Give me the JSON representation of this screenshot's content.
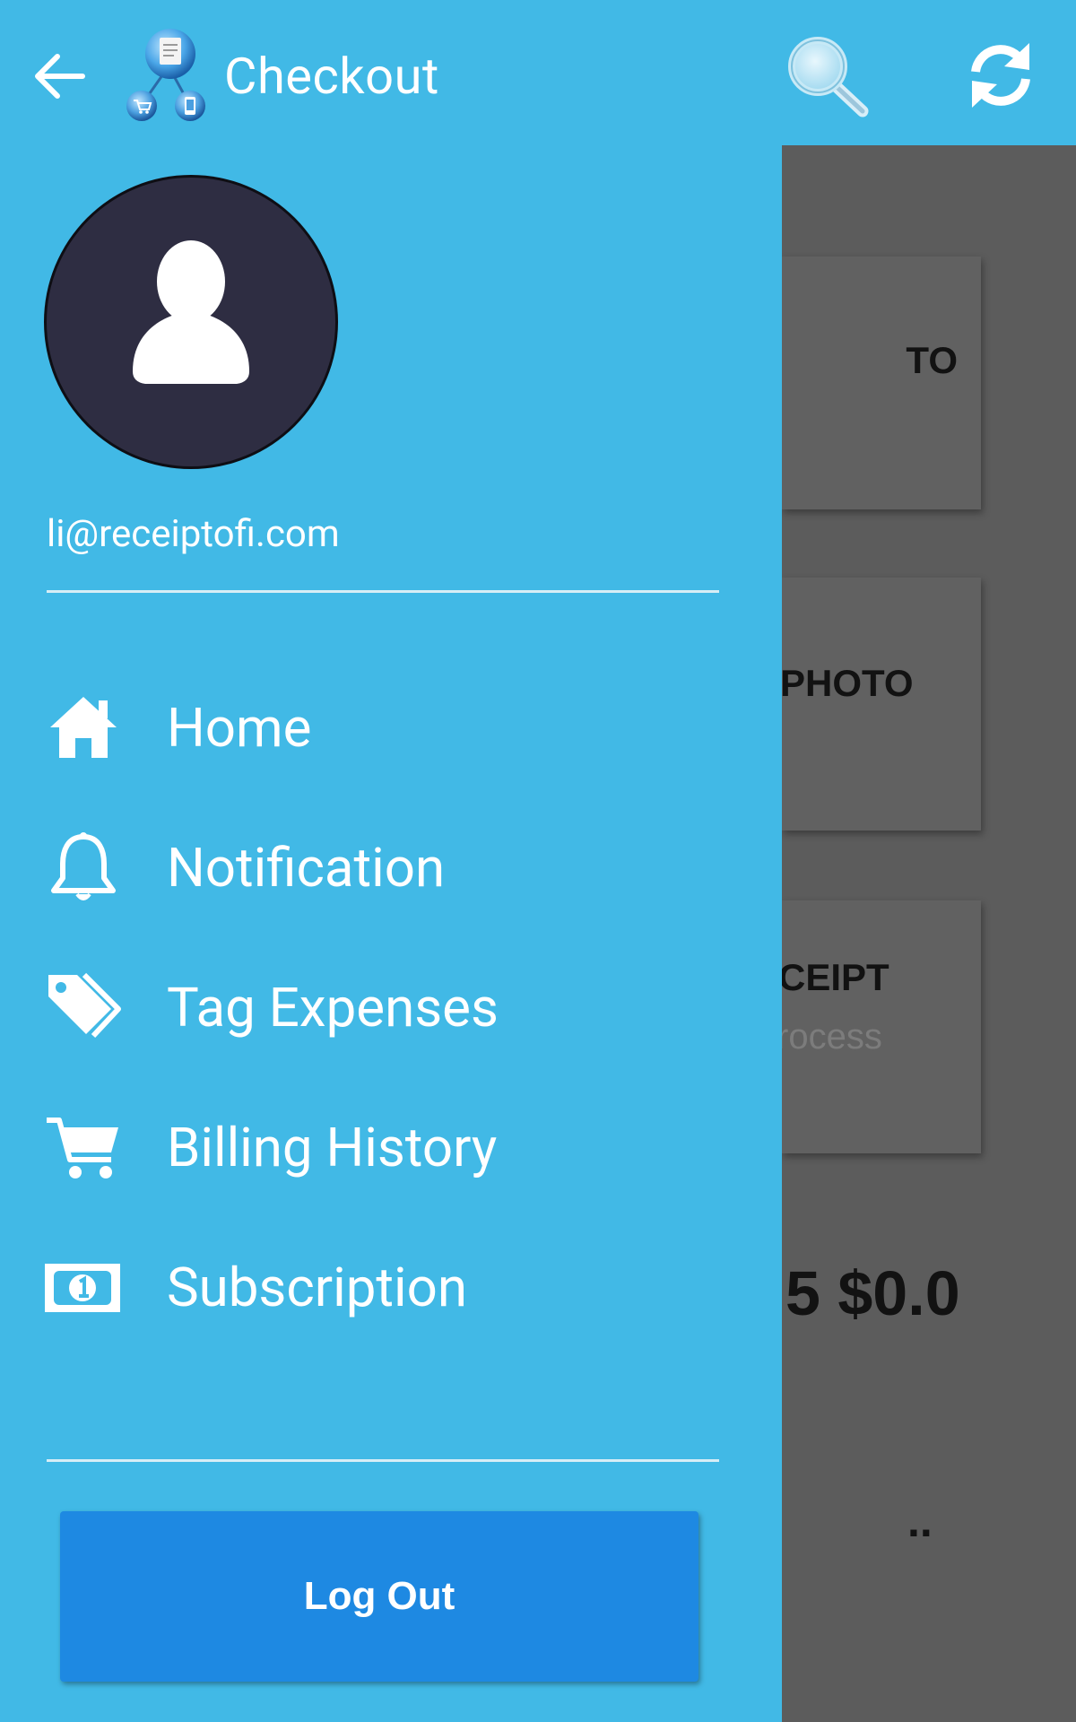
{
  "app_bar": {
    "title": "Checkout",
    "back_icon": "arrow-back-icon",
    "logo_icon": "receipt-app-logo-icon",
    "search_icon": "search-icon",
    "refresh_icon": "refresh-icon"
  },
  "drawer": {
    "email": "li@receiptofi.com",
    "avatar_icon": "user-avatar-icon",
    "nav_items": [
      {
        "label": "Home",
        "icon": "home-icon"
      },
      {
        "label": "Notification",
        "icon": "bell-icon"
      },
      {
        "label": "Tag Expenses",
        "icon": "tag-icon"
      },
      {
        "label": "Billing History",
        "icon": "cart-icon"
      },
      {
        "label": "Subscription",
        "icon": "money-bill-icon"
      }
    ],
    "logout_label": "Log Out"
  },
  "background": {
    "cards": [
      {
        "title": "TO",
        "subtitle": ""
      },
      {
        "title": "PHOTO",
        "subtitle": ""
      },
      {
        "title": "CEIPT",
        "subtitle": "rocess"
      }
    ],
    "amount_text": "5 $0.0",
    "dots_text": ".."
  },
  "colors": {
    "drawer_bg": "#41b9e6",
    "logout_button": "#1e89e2",
    "avatar_bg": "#2e2d42",
    "dim_overlay": "#5c5c5c"
  }
}
